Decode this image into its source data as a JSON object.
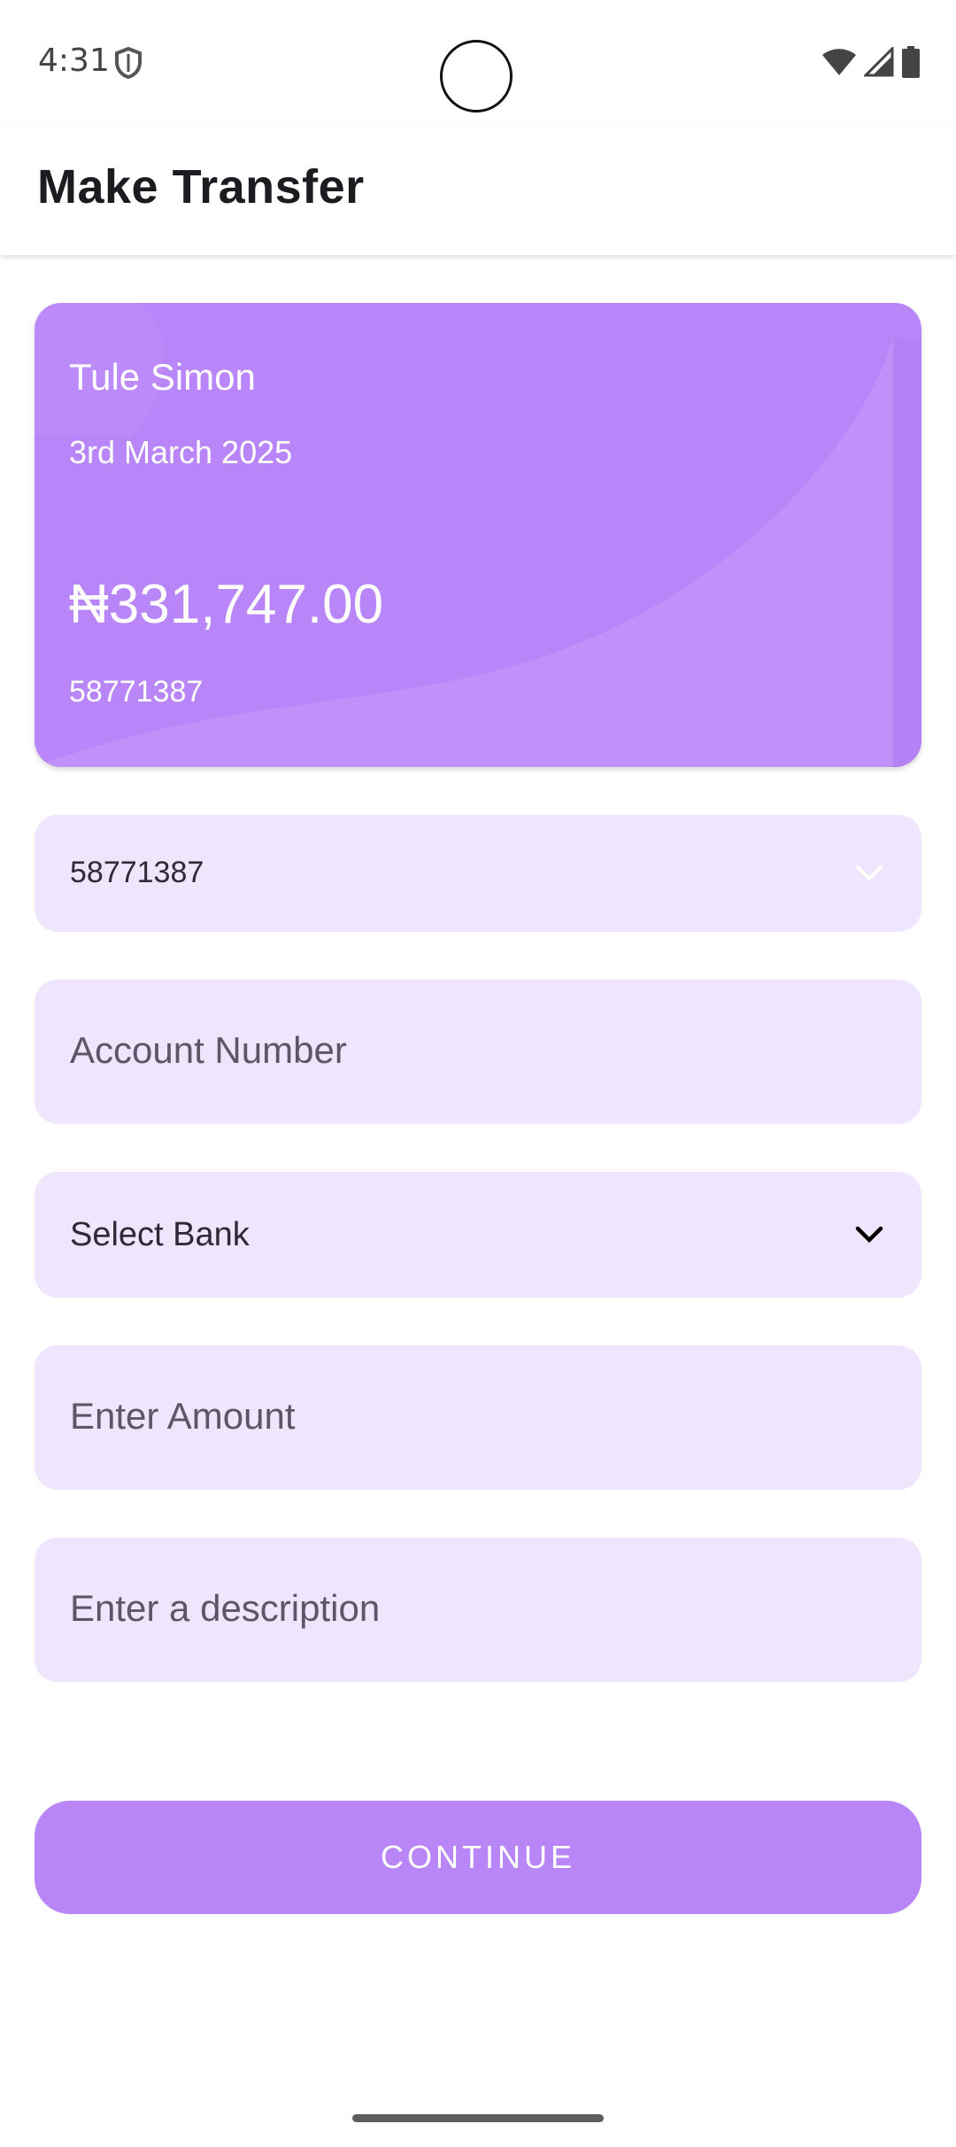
{
  "status_bar": {
    "time": "4:31",
    "icons": [
      "shield-icon",
      "wifi-icon",
      "signal-icon",
      "battery-icon"
    ]
  },
  "app_bar": {
    "title": "Make Transfer"
  },
  "card": {
    "name": "Tule Simon",
    "date": "3rd March 2025",
    "balance": "₦331,747.00",
    "account_number": "58771387"
  },
  "form": {
    "source_account": {
      "value": "58771387",
      "icon": "chevron-down-icon"
    },
    "account_number": {
      "placeholder": "Account Number"
    },
    "bank": {
      "value": "Select Bank",
      "icon": "chevron-down-icon"
    },
    "amount": {
      "placeholder": "Enter Amount"
    },
    "description": {
      "placeholder": "Enter a description"
    }
  },
  "actions": {
    "continue_label": "CONTINUE"
  },
  "colors": {
    "accent": "#b886f8",
    "field_background": "#efe5fc",
    "text_muted": "#5d5667"
  }
}
